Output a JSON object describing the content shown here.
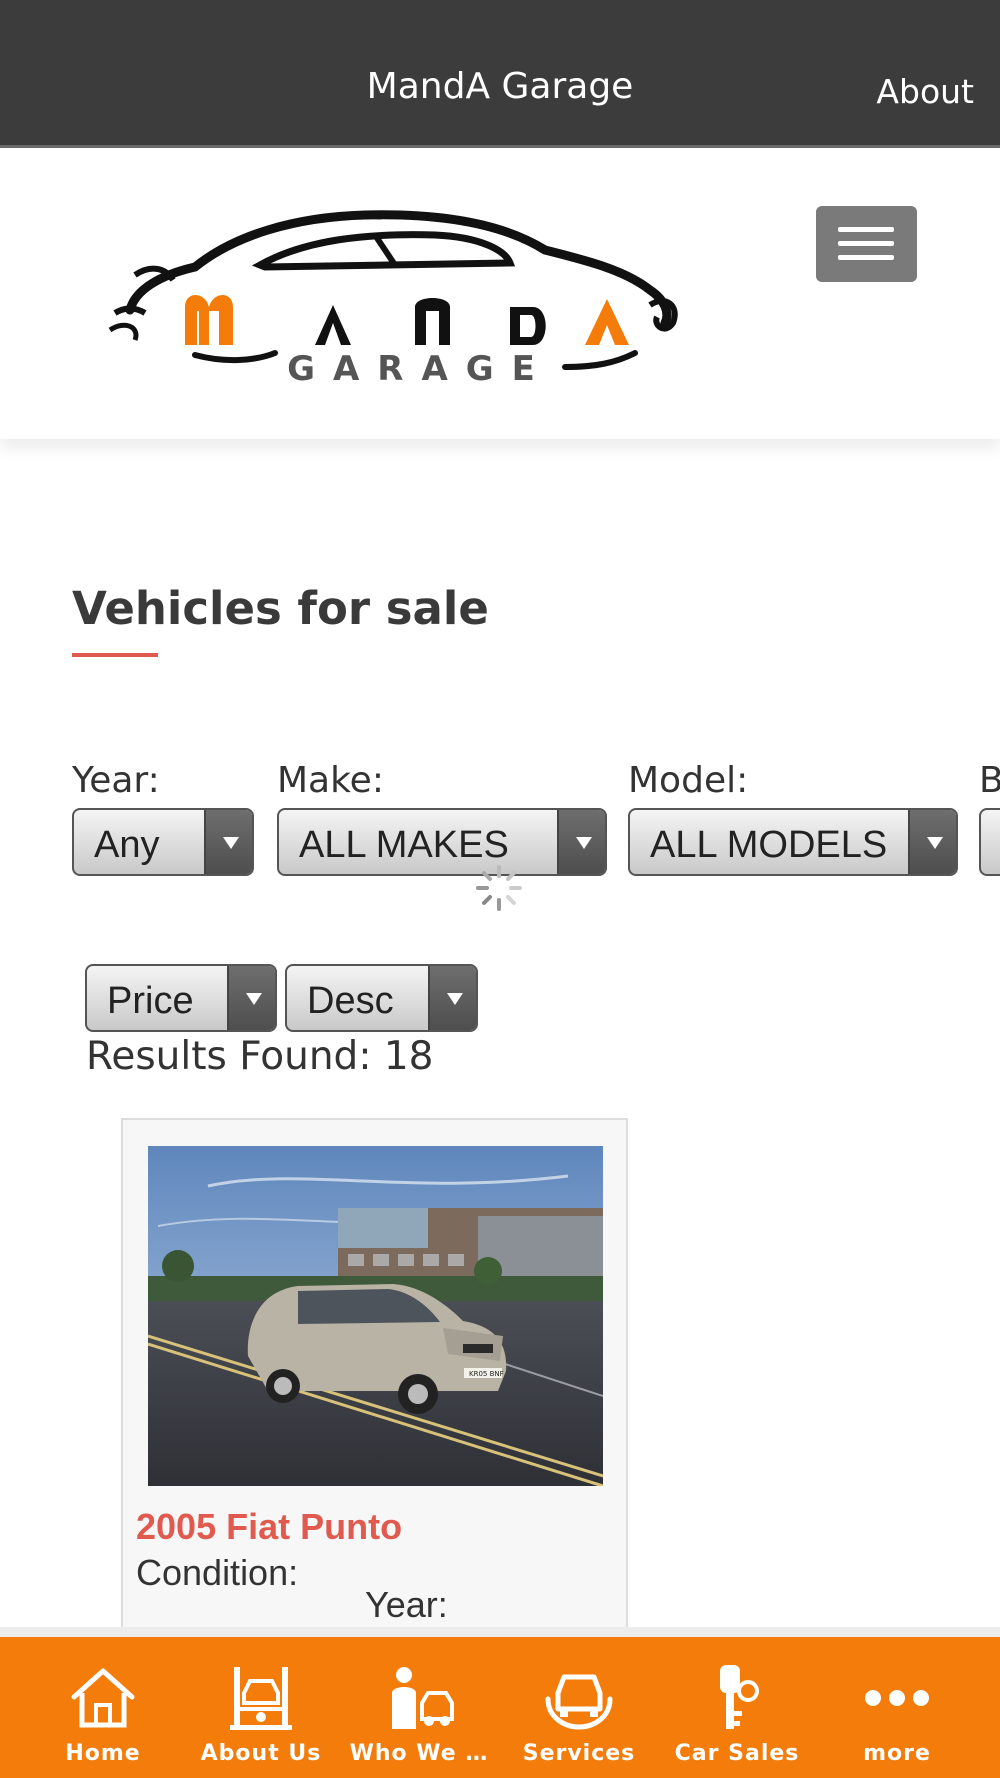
{
  "top_bar": {
    "title": "MandA Garage",
    "about_link": "About"
  },
  "logo": {
    "letters": "MANDA",
    "subtitle": "GARAGE"
  },
  "main": {
    "heading": "Vehicles for sale",
    "filters": {
      "year": {
        "label": "Year:",
        "value": "Any"
      },
      "make": {
        "label": "Make:",
        "value": "ALL MAKES"
      },
      "model": {
        "label": "Model:",
        "value": "ALL MODELS"
      },
      "fourth": {
        "label": "B"
      }
    },
    "sort": {
      "field": "Price",
      "order": "Desc"
    },
    "results_text": "Results Found: 18"
  },
  "vehicle": {
    "title": "2005 Fiat Punto",
    "condition_label": "Condition:",
    "year_label": "Year:",
    "plate": "KR05 BNF"
  },
  "bottom_nav": [
    {
      "label": "Home",
      "icon": "home-icon"
    },
    {
      "label": "About Us",
      "icon": "car-lift-icon"
    },
    {
      "label": "Who We …",
      "icon": "mechanic-icon"
    },
    {
      "label": "Services",
      "icon": "car-service-icon"
    },
    {
      "label": "Car Sales",
      "icon": "car-keys-icon"
    },
    {
      "label": "more",
      "icon": "more-dots-icon"
    }
  ],
  "colors": {
    "accent": "#f47c0a",
    "heading_rule": "#e05a4f",
    "topbar": "#3c3c3c"
  }
}
